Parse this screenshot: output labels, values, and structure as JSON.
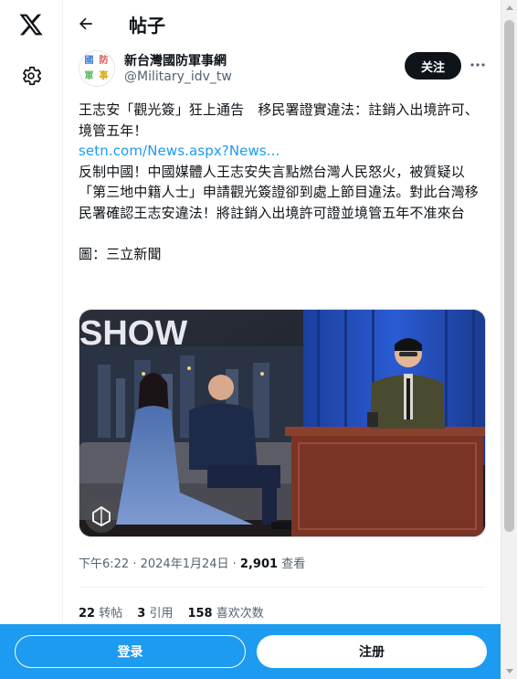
{
  "header": {
    "title": "帖子"
  },
  "author": {
    "name": "新台灣國防軍事網",
    "handle": "@Military_idv_tw",
    "avatar_glyphs": [
      "國",
      "防",
      "軍",
      "事"
    ]
  },
  "follow_label": "关注",
  "tweet": {
    "line1": "王志安「觀光簽」狂上通告　移民署證實違法：註銷入出境許可、境管五年！",
    "link": "setn.com/News.aspx?News...",
    "body": "反制中國！中國媒體人王志安失言點燃台灣人民怒火，被質疑以「第三地中籍人士」申請觀光簽證卻到處上節目違法。對此台灣移民署確認王志安違法！將註銷入出境許可證並境管五年不准來台",
    "credit": "圖：三立新聞"
  },
  "media": {
    "banner_text": "SHOW"
  },
  "meta": {
    "time": "下午6:22",
    "date": "2024年1月24日",
    "views": "2,901",
    "views_label": "查看"
  },
  "stats": {
    "reposts": "22",
    "reposts_label": "转帖",
    "quotes": "3",
    "quotes_label": "引用",
    "likes": "158",
    "likes_label": "喜欢次数"
  },
  "bottom": {
    "login_label": "登录",
    "signup_label": "注册"
  },
  "colors": {
    "accent": "#1d9bf0",
    "text": "#0f1419",
    "muted": "#536471"
  },
  "icons": [
    "x-logo-icon",
    "gear-icon",
    "back-arrow-icon",
    "more-icon",
    "play-icon"
  ]
}
